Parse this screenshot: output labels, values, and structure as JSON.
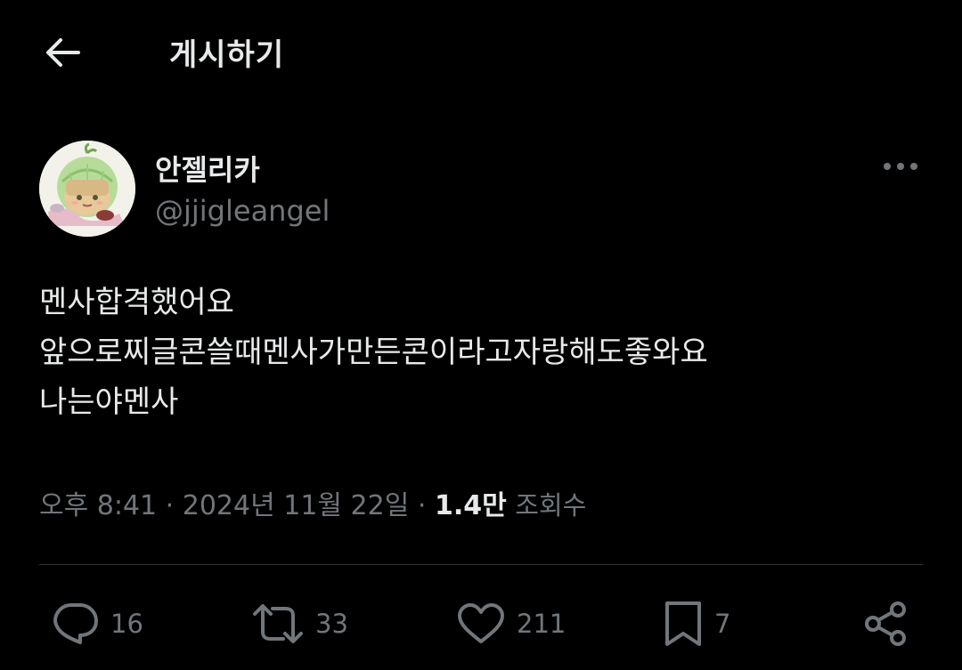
{
  "header": {
    "title": "게시하기",
    "back_icon": "arrow-left-icon"
  },
  "author": {
    "display_name": "안젤리카",
    "handle": "@jjigleangel"
  },
  "post": {
    "lines": [
      "멘사합격했어요",
      "앞으로찌글콘쓸때멘사가만든콘이라고자랑해도좋와요",
      "나는야멘사"
    ]
  },
  "meta": {
    "time": "오후 8:41",
    "separator": "·",
    "date": "2024년 11월 22일",
    "views_count": "1.4만",
    "views_label": "조회수"
  },
  "actions": {
    "reply": {
      "icon": "reply-icon",
      "count": "16"
    },
    "repost": {
      "icon": "repost-icon",
      "count": "33"
    },
    "like": {
      "icon": "heart-icon",
      "count": "211"
    },
    "bookmark": {
      "icon": "bookmark-icon",
      "count": "7"
    },
    "share": {
      "icon": "share-icon"
    }
  },
  "colors": {
    "background": "#000000",
    "text": "#e7e9ea",
    "secondary": "#71767b",
    "divider": "#2f3336"
  }
}
